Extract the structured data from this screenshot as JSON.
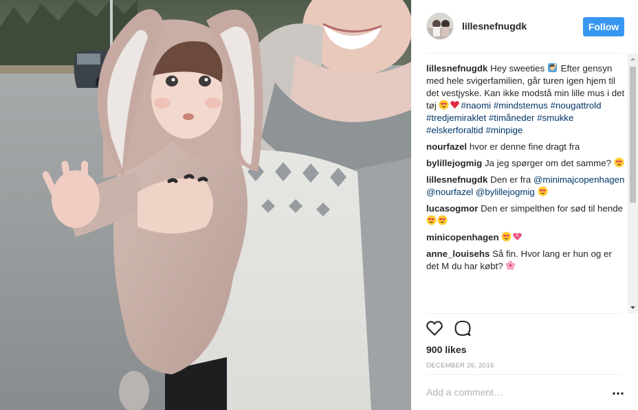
{
  "post": {
    "username": "lillesnefnugdk",
    "follow_label": "Follow",
    "caption": {
      "username": "lillesnefnugdk",
      "text_before_emoji": "Hey sweeties",
      "text_after_emoji": "Efter gensyn med hele svigerfamilien, går turen igen hjem til det vestjyske. Kan ikke modstå min lille mus i det tøj",
      "hashtags": [
        "#naomi",
        "#mindstemus",
        "#nougattrold",
        "#tredjemiraklet",
        "#timåneder",
        "#smukke",
        "#elskerforaltid",
        "#minpige"
      ]
    },
    "comments": [
      {
        "user": "nourfazel",
        "text": "hvor er denne fine dragt fra"
      },
      {
        "user": "bylillejogmig",
        "text": "Ja jeg spørger om det samme?"
      },
      {
        "user": "lillesnefnugdk",
        "text": "Den er fra",
        "mentions": [
          "@minimajcopenhagen",
          "@nourfazel",
          "@bylillejogmig"
        ]
      },
      {
        "user": "lucasogmor",
        "text": "Den er simpelthen for sød til hende"
      },
      {
        "user": "minicopenhagen",
        "text": ""
      },
      {
        "user": "anne_louisehs",
        "text": "Så fin. Hvor lang er hun og er det M du har købt?"
      }
    ],
    "likes": "900 likes",
    "date": "DECEMBER 26, 2016",
    "add_comment_placeholder": "Add a comment…"
  },
  "icons": {
    "heart": "heart-outline-icon",
    "comment": "speech-bubble-icon",
    "more": "ellipsis-icon",
    "emoji_smile_eyes": "heart-eyes-emoji",
    "emoji_heart": "red-heart-emoji",
    "emoji_woman_tipping": "woman-raising-hand-emoji",
    "emoji_blossom": "cherry-blossom-emoji"
  },
  "colors": {
    "follow": "#3897f0",
    "hashtag": "#003569",
    "text": "#262626",
    "muted": "#999999"
  }
}
